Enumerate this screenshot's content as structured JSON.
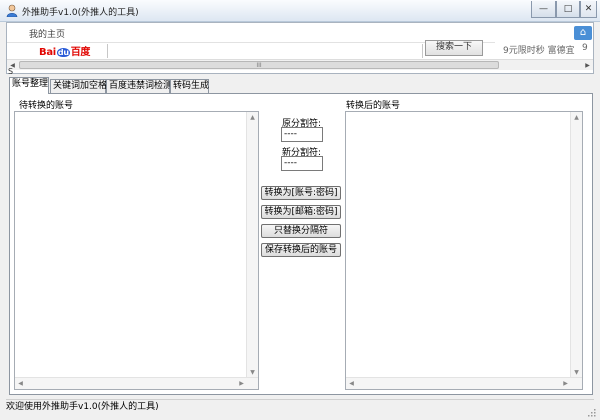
{
  "window": {
    "title": "外推助手v1.0(外推人的工具)",
    "icon": "person-icon",
    "controls": {
      "minimize": "—",
      "maximize": "□",
      "close": "✕"
    }
  },
  "browser": {
    "home_label": "我的主页",
    "home_icon": "home-icon",
    "baidu_logo_left": "Bai",
    "baidu_logo_du": "du",
    "baidu_logo_right": "百度",
    "search_button": "搜索一下",
    "promo_text": "9元限时秒  富德宜",
    "promo_more": "9",
    "scroll_grip": "III",
    "status_char": "S"
  },
  "tabs": [
    {
      "label": "账号整理",
      "active": true
    },
    {
      "label": "关键词加空格",
      "active": false
    },
    {
      "label": "百度违禁词检测",
      "active": false
    },
    {
      "label": "转码生成",
      "active": false
    }
  ],
  "panel": {
    "left_list_label": "待转换的账号",
    "right_list_label": "转换后的账号",
    "original_sep_label": "原分割符:",
    "original_sep_value": "----",
    "new_sep_label": "新分割符:",
    "new_sep_value": "----",
    "buttons": {
      "convert_account": "转换为[账号:密码]",
      "convert_email": "转换为[邮箱:密码]",
      "replace_sep": "只替换分隔符",
      "save": "保存转换后的账号"
    }
  },
  "status_bar": {
    "text": "欢迎使用外推助手v1.0(外推人的工具)"
  },
  "colors": {
    "titlebar": "#dde7f2",
    "accent": "#4a8fd6",
    "baidu_red": "#e10602",
    "baidu_blue": "#2a5bd7"
  }
}
